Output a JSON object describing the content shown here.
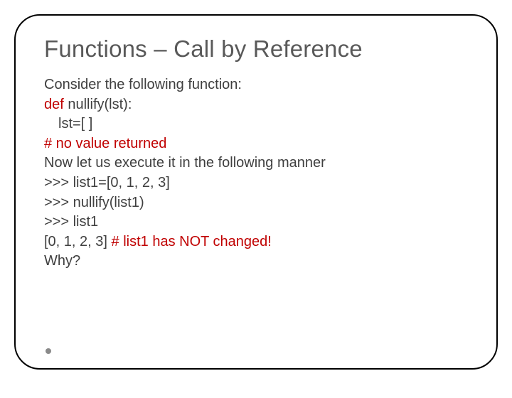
{
  "title": "Functions – Call by Reference",
  "lines": {
    "l0": {
      "a": "Consider the following function:"
    },
    "l1": {
      "a": "def",
      "b": " nullify(lst):"
    },
    "l2": {
      "a": "lst=[ ]"
    },
    "l3": {
      "a": "# no value returned"
    },
    "l4": {
      "a": "Now let us execute it in the following manner"
    },
    "l5": {
      "a": ">>> list1=[0, 1, 2, 3]"
    },
    "l6": {
      "a": ">>> nullify(list1)"
    },
    "l7": {
      "a": ">>> list1"
    },
    "l8": {
      "a": "[0, 1, 2, 3] ",
      "b": "# list1 has NOT changed!"
    },
    "l9": {
      "a": "Why?"
    }
  }
}
